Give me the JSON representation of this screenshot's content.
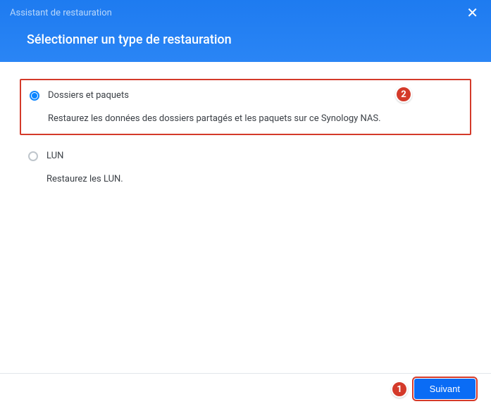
{
  "header": {
    "wizard_title": "Assistant de restauration",
    "step_title": "Sélectionner un type de restauration"
  },
  "options": {
    "folders_packages": {
      "label": "Dossiers et paquets",
      "description": "Restaurez les données des dossiers partagés et les paquets sur ce Synology NAS."
    },
    "lun": {
      "label": "LUN",
      "description": "Restaurez les LUN."
    }
  },
  "footer": {
    "next_label": "Suivant"
  },
  "callouts": {
    "one": "1",
    "two": "2"
  },
  "colors": {
    "accent": "#0a6cf5",
    "highlight": "#d43a2a",
    "header_bg": "#2a85f5"
  }
}
